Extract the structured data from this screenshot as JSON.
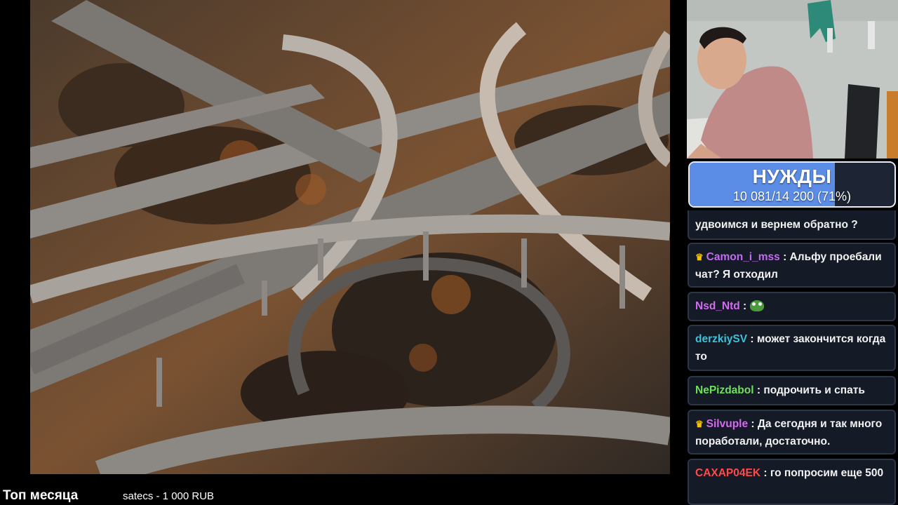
{
  "goal": {
    "title": "НУЖДЫ",
    "progress_text": "10 081/14 200 (71%)",
    "progress_fraction": 0.71,
    "fill_color": "#5b8de6"
  },
  "chat": {
    "messages": [
      {
        "user": "",
        "color": "#ffffff",
        "badge": "",
        "text": "удвоимся и вернем обратно ?"
      },
      {
        "user": "Camon_i_mss",
        "color": "#c36cf0",
        "badge": "crown-icon",
        "text": "Альфу проебали чат? Я отходил"
      },
      {
        "user": "Nsd_Ntd",
        "color": "#d36cf0",
        "badge": "",
        "text": "",
        "emote": "pepe-emote-icon"
      },
      {
        "user": "derzkiySV",
        "color": "#3ec2d9",
        "badge": "",
        "text": "может закончится когда то"
      },
      {
        "user": "NePizdabol",
        "color": "#6ee05a",
        "badge": "",
        "text": "подрочить и спать"
      },
      {
        "user": "Silvuple",
        "color": "#d36cf0",
        "badge": "crown-icon",
        "text": "Да сегодня и так много поработали, достаточно."
      },
      {
        "user": "CAXAP04EK",
        "color": "#ff4a4a",
        "badge": "",
        "text": "го попросим еще 500"
      }
    ]
  },
  "ticker": {
    "label": "Топ месяца",
    "item": "satecs - 1 000 RUB"
  },
  "colors": {
    "chat_bg": "#141a26",
    "chat_border": "#2d3546",
    "badge": "#f4c20d"
  }
}
